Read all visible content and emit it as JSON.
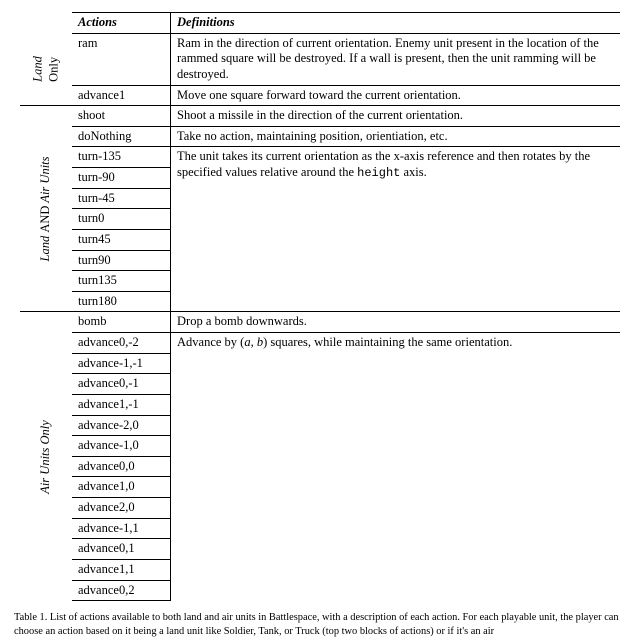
{
  "headers": {
    "actions": "Actions",
    "definitions": "Definitions"
  },
  "cats": {
    "land_only": "Land\nOnly",
    "land_air": "Land AND Air Units",
    "air_only": "Air Units Only"
  },
  "land": {
    "ram": {
      "name": "ram",
      "def": "Ram in the direction of current orientation. Enemy unit present in the location of the rammed square will be destroyed. If a wall is present, then the unit ramming will be destroyed."
    },
    "advance1": {
      "name": "advance1",
      "def": "Move one square forward toward the current orientation."
    }
  },
  "both": {
    "shoot": {
      "name": "shoot",
      "def": "Shoot a missile in the direction of the current orientation."
    },
    "doNothing": {
      "name": "doNothing",
      "def": "Take no action, maintaining position, orientiation, etc."
    },
    "turns": {
      "names": [
        "turn-135",
        "turn-90",
        "turn-45",
        "turn0",
        "turn45",
        "turn90",
        "turn135",
        "turn180"
      ],
      "def_pre": "The unit takes its current orientation as the x-axis reference and then rotates by the specified values relative around the ",
      "def_code": "height",
      "def_post": " axis."
    }
  },
  "air": {
    "bomb": {
      "name": "bomb",
      "def": "Drop a bomb downwards."
    },
    "advances": {
      "names": [
        "advance0,-2",
        "advance-1,-1",
        "advance0,-1",
        "advance1,-1",
        "advance-2,0",
        "advance-1,0",
        "advance0,0",
        "advance1,0",
        "advance2,0",
        "advance-1,1",
        "advance0,1",
        "advance1,1",
        "advance0,2"
      ],
      "def_pre": "Advance by (",
      "def_ab": "a, b",
      "def_post": ") squares, while maintaining the same orientation."
    }
  },
  "caption": "Table 1. List of actions available to both land and air units in Battlespace, with a description of each action. For each playable unit, the player can choose an action based on it being a land unit like Soldier, Tank, or Truck (top two blocks of actions) or if it's an air"
}
